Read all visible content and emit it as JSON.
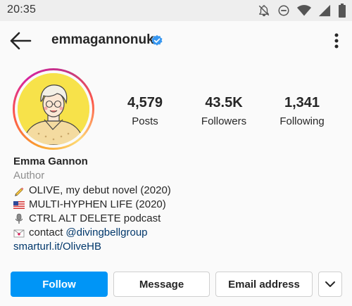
{
  "status_bar": {
    "time": "20:35",
    "icons": [
      "notifications-off-icon",
      "do-not-disturb-icon",
      "wifi-icon",
      "signal-icon",
      "battery-icon"
    ]
  },
  "header": {
    "username": "emmagannonuk",
    "verified": true,
    "back_icon": "arrow-left-icon",
    "more_icon": "more-vertical-icon"
  },
  "profile": {
    "stats": [
      {
        "value": "4,579",
        "label": "Posts"
      },
      {
        "value": "43.5K",
        "label": "Followers"
      },
      {
        "value": "1,341",
        "label": "Following"
      }
    ],
    "name": "Emma Gannon",
    "category": "Author",
    "bio_lines": [
      {
        "icon": "pencil-emoji",
        "text": "OLIVE, my debut novel (2020)"
      },
      {
        "icon": "us-flag-emoji",
        "text": "MULTI-HYPHEN LIFE (2020)"
      },
      {
        "icon": "microphone-emoji",
        "text": "CTRL ALT DELETE podcast"
      },
      {
        "icon": "love-letter-emoji",
        "text": "contact",
        "mention": "@divingbellgroup"
      }
    ],
    "link": "smarturl.it/OliveHB"
  },
  "actions": {
    "follow": "Follow",
    "message": "Message",
    "email": "Email address",
    "more_icon": "chevron-down-icon"
  },
  "colors": {
    "primary_button": "#0095f6",
    "link": "#00376b",
    "verified_badge": "#3897f0",
    "secondary_text": "#8e8e8e"
  }
}
